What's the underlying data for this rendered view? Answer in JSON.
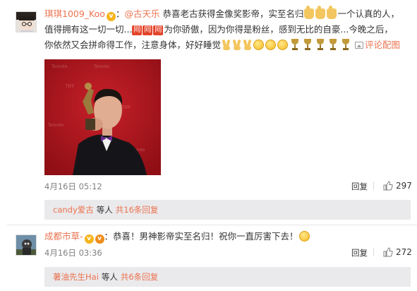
{
  "comments": [
    {
      "username": "琪琪1009_Koo",
      "mention": "@古天乐",
      "text_part1": "恭喜老古获得金像奖影帝，实至名归",
      "text_part2": "一个认真的人，值得拥有这一切一切...",
      "text_part3": "为你骄傲，因为你得是粉丝，感到无比的自豪...今晚之后，你依然又会拼命得工作，注意身体，好好睡觉",
      "hui_label": "囘",
      "pic_label": "评论配图",
      "date": "4月16日 05:12",
      "reply_label": "回复",
      "likes": "297",
      "sub_user": "candy爱古",
      "sub_etc": "等人",
      "sub_more": "共16条回复"
    },
    {
      "username": "成都市草-",
      "text": "恭喜！男神影帝实至名归！祝你一直厉害下去！",
      "date": "4月16日 03:36",
      "reply_label": "回复",
      "likes": "272",
      "sub_user": "薯油先生Hai",
      "sub_etc": "等人",
      "sub_more": "共6条回复"
    }
  ],
  "colors": {
    "accent": "#eb7350",
    "subreply_bg": "#eaeaec",
    "photo_bg": "#b3161d"
  },
  "icons": {
    "verified": "v-badge-icon",
    "like": "thumbs-up-icon",
    "picture": "picture-icon"
  }
}
